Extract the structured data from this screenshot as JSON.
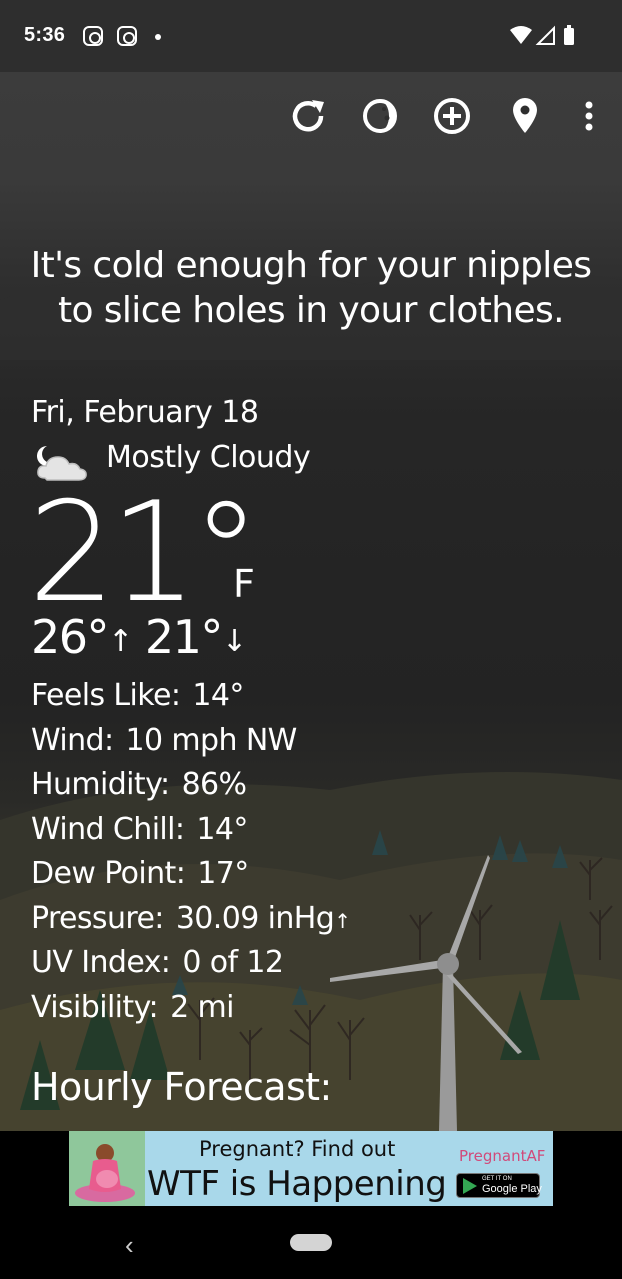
{
  "status_bar": {
    "time": "5:36"
  },
  "quote": "It's cold enough for your nipples to slice holes in your clothes.",
  "weather": {
    "date": "Fri, February 18",
    "condition": "Mostly Cloudy",
    "temperature": "21°",
    "unit": "F",
    "high": "26°",
    "low": "21°",
    "high_arrow": "↑",
    "low_arrow": "↓"
  },
  "details": [
    {
      "label": "Feels Like:",
      "value": "14°"
    },
    {
      "label": "Wind:",
      "value": "10 mph NW"
    },
    {
      "label": "Humidity:",
      "value": "86%"
    },
    {
      "label": "Wind Chill:",
      "value": "14°"
    },
    {
      "label": "Dew Point:",
      "value": "17°"
    },
    {
      "label": "Pressure:",
      "value": "30.09 inHg",
      "trend": "↑"
    },
    {
      "label": "UV Index:",
      "value": "0 of 12"
    },
    {
      "label": "Visibility:",
      "value": "2 mi"
    }
  ],
  "hourly_title": "Hourly Forecast:",
  "ad": {
    "line1": "Pregnant? Find out",
    "line2": "WTF is Happening",
    "brand": "PregnantAF",
    "play_small": "GET IT ON",
    "play_text": "Google Play"
  },
  "nav": {
    "back": "‹"
  },
  "icons": {
    "refresh": "refresh-icon",
    "theme": "theme-icon",
    "add": "add-location-icon",
    "location": "location-pin-icon",
    "menu": "more-vert-icon",
    "condition": "partly-cloudy-night-icon"
  }
}
